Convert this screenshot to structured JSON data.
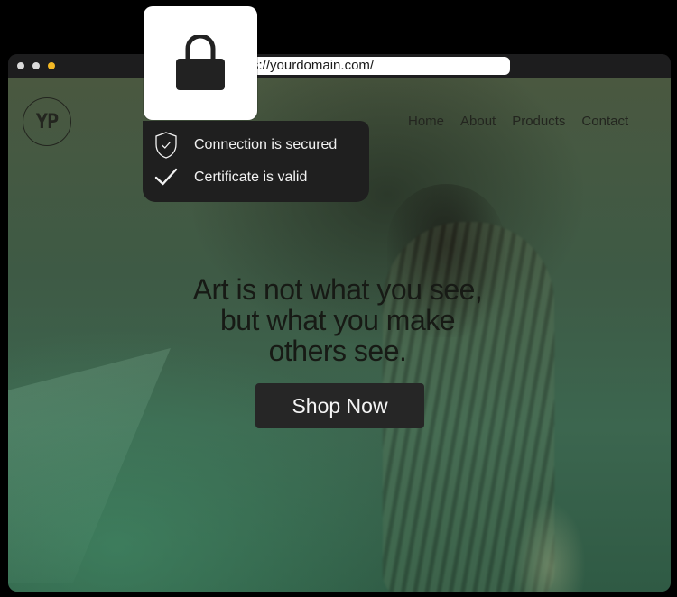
{
  "browser": {
    "url": "https://yourdomain.com/"
  },
  "site": {
    "logo_text": "YP",
    "nav": [
      "Home",
      "About",
      "Products",
      "Contact"
    ],
    "hero_lines": [
      "Art is not what you see,",
      "but what you make",
      "others see."
    ],
    "cta_label": "Shop Now"
  },
  "security": {
    "connection_text": "Connection is secured",
    "certificate_text": "Certificate is valid",
    "icons": [
      "lock-icon",
      "shield-check-icon",
      "check-icon"
    ]
  },
  "colors": {
    "accent_dot": "#f2b824",
    "button_bg": "#262626",
    "popup_bg": "#1f1f1f"
  }
}
